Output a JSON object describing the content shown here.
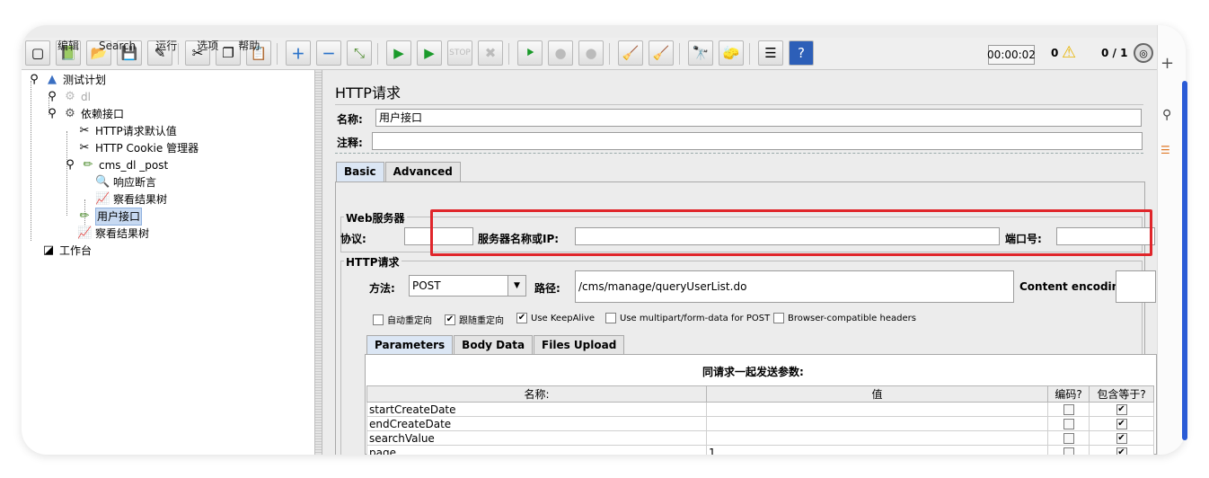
{
  "menu": [
    "编辑",
    "Search",
    "运行",
    "选项",
    "帮助"
  ],
  "toolbar": {
    "icons": [
      "new-icon",
      "templates-icon",
      "open-icon",
      "save-icon",
      "save-as-icon",
      "cut-icon",
      "copy-icon",
      "paste-icon",
      "expand-icon",
      "collapse-icon",
      "toggle-icon",
      "start-icon",
      "start-no-pause-icon",
      "stop-icon",
      "shutdown-icon",
      "remote-start-icon",
      "remote-stop-icon",
      "remote-shutdown-icon",
      "clear-icon",
      "clear-all-icon",
      "search-icon",
      "reset-search-icon",
      "function-helper-icon",
      "help-icon"
    ],
    "timer": "00:00:02",
    "warnings": "0",
    "threads": "0 / 1"
  },
  "tree": {
    "items": [
      {
        "label": "测试计划",
        "icon": "test-plan-icon"
      },
      {
        "label": "dl",
        "icon": "thread-group-icon"
      },
      {
        "label": "依赖接口",
        "icon": "thread-group-icon"
      },
      {
        "label": "HTTP请求默认值",
        "icon": "config-element-icon"
      },
      {
        "label": "HTTP Cookie 管理器",
        "icon": "config-element-icon"
      },
      {
        "label": "cms_dl _post",
        "icon": "sampler-icon"
      },
      {
        "label": "响应断言",
        "icon": "assertion-icon"
      },
      {
        "label": "察看结果树",
        "icon": "listener-icon"
      },
      {
        "label": "用户接口",
        "icon": "sampler-icon"
      },
      {
        "label": "察看结果树",
        "icon": "listener-icon"
      },
      {
        "label": "工作台",
        "icon": "workbench-icon"
      }
    ]
  },
  "sampler": {
    "title": "HTTP请求",
    "name_label": "名称:",
    "name_value": "用户接口",
    "comment_label": "注释:",
    "comment_value": "",
    "tabs": [
      "Basic",
      "Advanced"
    ],
    "web_server": {
      "group_title": "Web服务器",
      "protocol_label": "协议:",
      "protocol_value": "",
      "server_label": "服务器名称或IP:",
      "server_value": "",
      "port_label": "端口号:",
      "port_value": ""
    },
    "http_request": {
      "group_title": "HTTP请求",
      "method_label": "方法:",
      "method_value": "POST",
      "path_label": "路径:",
      "path_value": "/cms/manage/queryUserList.do",
      "encoding_label": "Content encoding:",
      "encoding_value": ""
    },
    "options": [
      {
        "label": "自动重定向",
        "checked": false
      },
      {
        "label": "跟随重定向",
        "checked": true
      },
      {
        "label": "Use KeepAlive",
        "checked": true
      },
      {
        "label": "Use multipart/form-data for POST",
        "checked": false
      },
      {
        "label": "Browser-compatible headers",
        "checked": false
      }
    ],
    "param_tabs": [
      "Parameters",
      "Body Data",
      "Files Upload"
    ],
    "params_caption": "同请求一起发送参数:",
    "columns": [
      "名称:",
      "值",
      "编码?",
      "包含等于?"
    ],
    "rows": [
      {
        "name": "startCreateDate",
        "value": "",
        "encode": false,
        "include_equals": true
      },
      {
        "name": "endCreateDate",
        "value": "",
        "encode": false,
        "include_equals": true
      },
      {
        "name": "searchValue",
        "value": "",
        "encode": false,
        "include_equals": true
      },
      {
        "name": "page",
        "value": "1",
        "encode": false,
        "include_equals": true
      }
    ]
  },
  "colors": {
    "highlight_box": "#e0262b",
    "selection": "#c7d9f1",
    "accent_edge": "#2a5bd6"
  }
}
